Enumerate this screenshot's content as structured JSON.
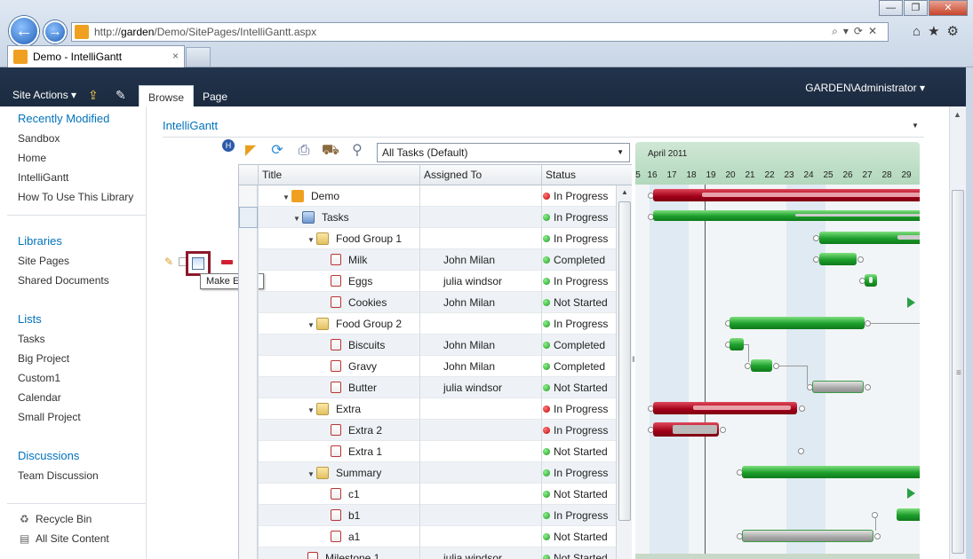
{
  "browser": {
    "url_prefix": "http://",
    "url_host": "garden",
    "url_path": "/Demo/SitePages/IntelliGantt.aspx",
    "tab_title": "Demo - IntelliGantt",
    "tab_close": "×",
    "win_min": "—",
    "win_max": "❐",
    "win_close": "✕",
    "addr_tools": "⌕▾⟳✕",
    "chrome_icons": "⌂★⚙",
    "back_glyph": "←",
    "fwd_glyph": "→"
  },
  "ribbon": {
    "site_actions": "Site Actions ▾",
    "tabs": [
      "Browse",
      "Page"
    ],
    "user": "GARDEN\\Administrator ▾"
  },
  "leftnav": {
    "recently_modified": "Recently Modified",
    "recent_items": [
      "Sandbox",
      "Home",
      "IntelliGantt",
      "How To Use This Library"
    ],
    "libraries": "Libraries",
    "library_items": [
      "Site Pages",
      "Shared Documents"
    ],
    "lists": "Lists",
    "list_items": [
      "Tasks",
      "Big Project",
      "Custom1",
      "Calendar",
      "Small Project"
    ],
    "discussions": "Discussions",
    "discussion_items": [
      "Team Discussion"
    ],
    "recycle_bin": "Recycle Bin",
    "all_site_content": "All Site Content"
  },
  "webpart": {
    "title": "IntelliGantt",
    "view_select": "All Tasks (Default)"
  },
  "grid": {
    "columns": [
      "Title",
      "Assigned To",
      "Status"
    ],
    "rows": [
      {
        "title": "Demo",
        "assigned": "",
        "status": "In Progress",
        "status_color": "red",
        "indent": 1,
        "icon": "site",
        "expand": true
      },
      {
        "title": "Tasks",
        "assigned": "",
        "status": "In Progress",
        "status_color": "green",
        "indent": 2,
        "icon": "tasks",
        "expand": true
      },
      {
        "title": "Food Group 1",
        "assigned": "",
        "status": "In Progress",
        "status_color": "green",
        "indent": 3,
        "icon": "folder",
        "expand": true
      },
      {
        "title": "Milk",
        "assigned": "John Milan",
        "status": "Completed",
        "status_color": "green",
        "indent": 4,
        "icon": "task",
        "expand": false
      },
      {
        "title": "Eggs",
        "assigned": "julia windsor",
        "status": "In Progress",
        "status_color": "green",
        "indent": 4,
        "icon": "task",
        "expand": false
      },
      {
        "title": "Cookies",
        "assigned": "John Milan",
        "status": "Not Started",
        "status_color": "green",
        "indent": 4,
        "icon": "task",
        "expand": false
      },
      {
        "title": "Food Group 2",
        "assigned": "",
        "status": "In Progress",
        "status_color": "green",
        "indent": 3,
        "icon": "folder",
        "expand": true
      },
      {
        "title": "Biscuits",
        "assigned": "John Milan",
        "status": "Completed",
        "status_color": "green",
        "indent": 4,
        "icon": "task",
        "expand": false
      },
      {
        "title": "Gravy",
        "assigned": "John Milan",
        "status": "Completed",
        "status_color": "green",
        "indent": 4,
        "icon": "task",
        "expand": false
      },
      {
        "title": "Butter",
        "assigned": "julia windsor",
        "status": "Not Started",
        "status_color": "green",
        "indent": 4,
        "icon": "task",
        "expand": false
      },
      {
        "title": "Extra",
        "assigned": "",
        "status": "In Progress",
        "status_color": "red",
        "indent": 3,
        "icon": "folder",
        "expand": true
      },
      {
        "title": "Extra 2",
        "assigned": "",
        "status": "In Progress",
        "status_color": "red",
        "indent": 4,
        "icon": "task",
        "expand": false
      },
      {
        "title": "Extra 1",
        "assigned": "",
        "status": "Not Started",
        "status_color": "green",
        "indent": 4,
        "icon": "task",
        "expand": false
      },
      {
        "title": "Summary",
        "assigned": "",
        "status": "In Progress",
        "status_color": "green",
        "indent": 3,
        "icon": "folder",
        "expand": true
      },
      {
        "title": "c1",
        "assigned": "",
        "status": "Not Started",
        "status_color": "green",
        "indent": 4,
        "icon": "task",
        "expand": false
      },
      {
        "title": "b1",
        "assigned": "",
        "status": "In Progress",
        "status_color": "green",
        "indent": 4,
        "icon": "task",
        "expand": false
      },
      {
        "title": "a1",
        "assigned": "",
        "status": "Not Started",
        "status_color": "green",
        "indent": 4,
        "icon": "task",
        "expand": false
      },
      {
        "title": "Milestone 1",
        "assigned": "julia windsor",
        "status": "Not Started",
        "status_color": "green",
        "indent": 3,
        "icon": "task",
        "expand": false
      }
    ]
  },
  "gantt": {
    "month": "April 2011",
    "days": [
      "5",
      "16",
      "17",
      "18",
      "19",
      "20",
      "21",
      "22",
      "23",
      "24",
      "25",
      "26",
      "27",
      "28",
      "29"
    ]
  },
  "tooltip": "Make Event",
  "colors": {
    "ribbon_bg": "#1b2a3f",
    "link_blue": "#0072bc",
    "status_red": "#c00000",
    "status_green": "#1c9a1c"
  }
}
